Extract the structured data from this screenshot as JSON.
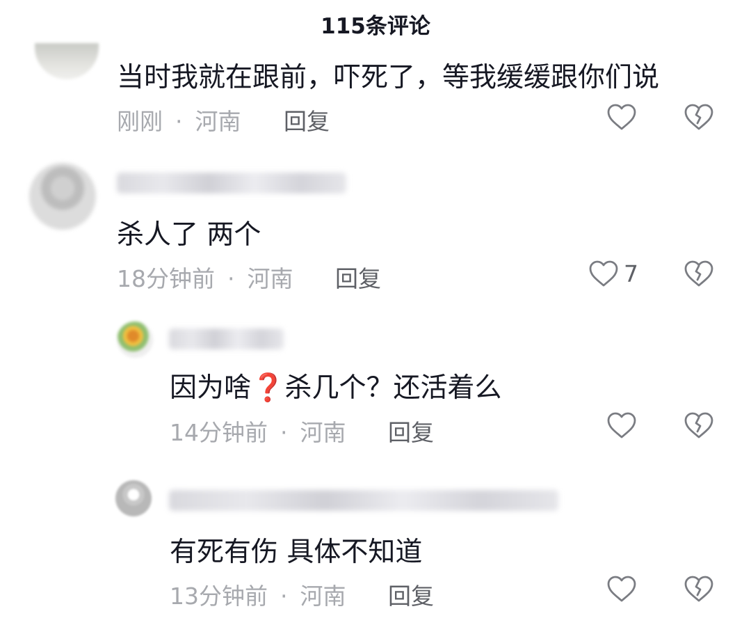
{
  "header": {
    "title": "115条评论"
  },
  "comments": [
    {
      "text": "当时我就在跟前，吓死了，等我缓缓跟你们说",
      "time": "刚刚",
      "separator": "·",
      "location": "河南",
      "reply_label": "回复",
      "like_count": ""
    },
    {
      "text": "杀人了 两个",
      "time": "18分钟前",
      "separator": "·",
      "location": "河南",
      "reply_label": "回复",
      "like_count": "7"
    },
    {
      "text": "因为啥❓杀几个？还活着么",
      "time": "14分钟前",
      "separator": "·",
      "location": "河南",
      "reply_label": "回复",
      "like_count": ""
    },
    {
      "text": "有死有伤 具体不知道",
      "time": "13分钟前",
      "separator": "·",
      "location": "河南",
      "reply_label": "回复",
      "like_count": ""
    }
  ],
  "icons": {
    "like": "heart-outline-icon",
    "dislike": "broken-heart-icon"
  },
  "colors": {
    "text": "#161823",
    "meta": "#a7a9ae",
    "reply": "#5e6066",
    "icon_stroke": "#7a7c82"
  }
}
